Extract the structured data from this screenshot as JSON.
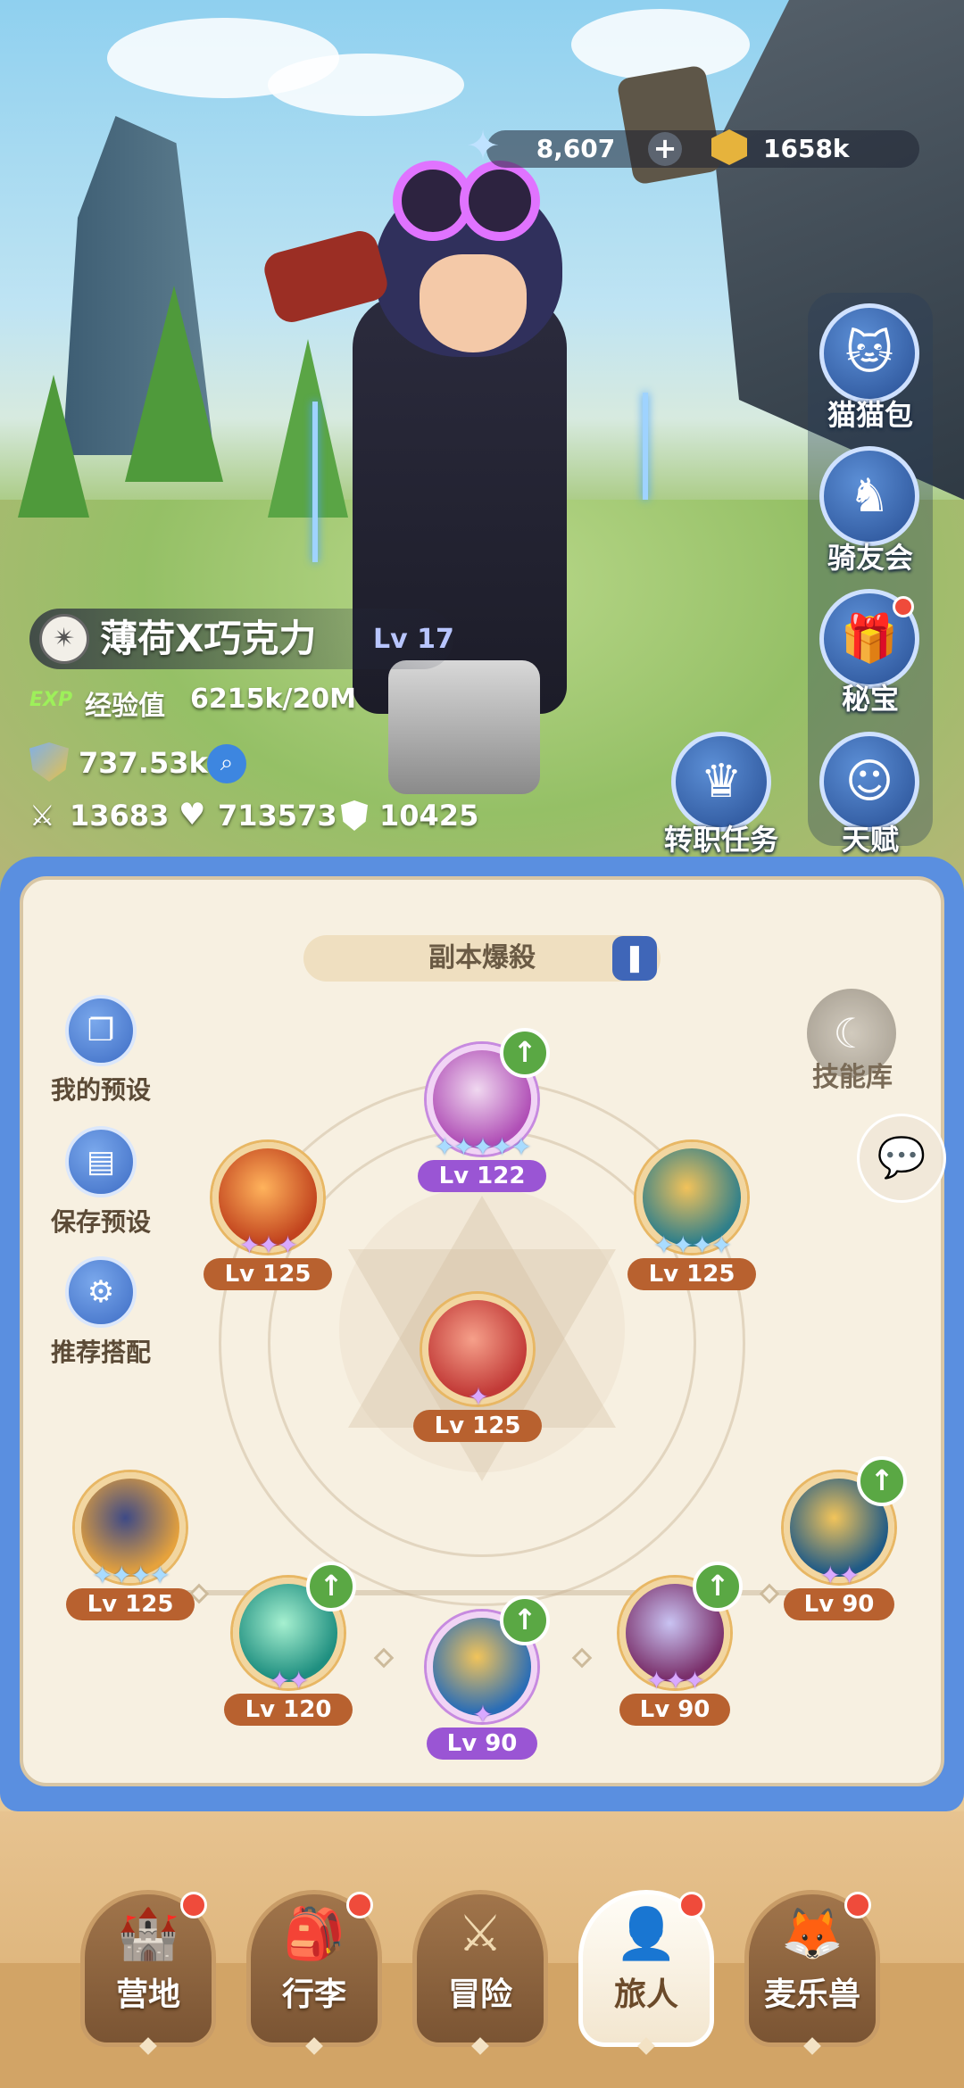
{
  "currency": {
    "gems": "8,607",
    "plus": "+",
    "gold": "1658k"
  },
  "side_menu": [
    {
      "label": "猫猫包",
      "icon": "cat-bag-icon",
      "glyph": "🐱"
    },
    {
      "label": "骑友会",
      "icon": "horse-icon",
      "glyph": "♞"
    },
    {
      "label": "秘宝",
      "icon": "treasure-icon",
      "glyph": "🎁",
      "badge": true
    },
    {
      "label": "天赋",
      "icon": "talent-head-icon",
      "glyph": "☺"
    }
  ],
  "job_quest": {
    "label": "转职任务",
    "glyph": "♛"
  },
  "character": {
    "name": "薄荷X巧克力",
    "level": "Lv 17",
    "exp_badge": "EXP",
    "exp_label": "经验值",
    "exp_value": "6215k/20M",
    "power": "737.53k",
    "attack": "13683",
    "hp": "713573",
    "defense": "10425"
  },
  "panel": {
    "tab_title": "副本爆殺",
    "left_buttons": [
      {
        "label": "我的预设",
        "glyph": "❐"
      },
      {
        "label": "保存预设",
        "glyph": "▤"
      },
      {
        "label": "推荐搭配",
        "glyph": "⚙"
      }
    ],
    "skill_lib": "技能库"
  },
  "skills": [
    {
      "id": "top",
      "level": "Lv 122",
      "stars": "✦✦✦✦✦",
      "star_color": "blue",
      "upgrade": true,
      "style": "purple",
      "colors": [
        "#b04fb6",
        "#f0d8f0"
      ]
    },
    {
      "id": "upper-left",
      "level": "Lv 125",
      "stars": "✦✦✦",
      "star_color": "purple",
      "upgrade": false,
      "style": "orange",
      "colors": [
        "#c2441e",
        "#ffb35c"
      ]
    },
    {
      "id": "upper-right",
      "level": "Lv 125",
      "stars": "✦✦✦✦",
      "star_color": "blue",
      "upgrade": false,
      "style": "orange",
      "colors": [
        "#2f7f8a",
        "#f2c25a"
      ]
    },
    {
      "id": "center",
      "level": "Lv 125",
      "stars": "✦",
      "star_color": "purple",
      "upgrade": false,
      "style": "orange",
      "colors": [
        "#c23a37",
        "#f6a08a"
      ]
    },
    {
      "id": "bottom-1",
      "level": "Lv 125",
      "stars": "✦✦✦✦",
      "star_color": "blue",
      "upgrade": false,
      "style": "orange",
      "colors": [
        "#e6a23c",
        "#3e4a86"
      ]
    },
    {
      "id": "bottom-2",
      "level": "Lv 120",
      "stars": "✦✦",
      "star_color": "purple",
      "upgrade": true,
      "style": "orange",
      "colors": [
        "#1f8f80",
        "#a6f0d0"
      ]
    },
    {
      "id": "bottom-3",
      "level": "Lv 90",
      "stars": "✦",
      "star_color": "purple",
      "upgrade": true,
      "style": "purple",
      "colors": [
        "#2a6db6",
        "#f2c45a"
      ]
    },
    {
      "id": "bottom-4",
      "level": "Lv 90",
      "stars": "✦✦✦",
      "star_color": "purple",
      "upgrade": true,
      "style": "orange",
      "colors": [
        "#7a2f6a",
        "#c9c3f2"
      ]
    },
    {
      "id": "bottom-5",
      "level": "Lv 90",
      "stars": "✦✦",
      "star_color": "purple",
      "upgrade": true,
      "style": "orange",
      "colors": [
        "#1f5a86",
        "#f2c45a"
      ]
    }
  ],
  "nav": [
    {
      "label": "营地",
      "glyph": "🏰",
      "badge": true,
      "active": false
    },
    {
      "label": "行李",
      "glyph": "🎒",
      "badge": true,
      "active": false
    },
    {
      "label": "冒险",
      "glyph": "⚔",
      "badge": false,
      "active": false
    },
    {
      "label": "旅人",
      "glyph": "👤",
      "badge": true,
      "active": true
    },
    {
      "label": "麦乐兽",
      "glyph": "🦊",
      "badge": true,
      "active": false
    }
  ]
}
